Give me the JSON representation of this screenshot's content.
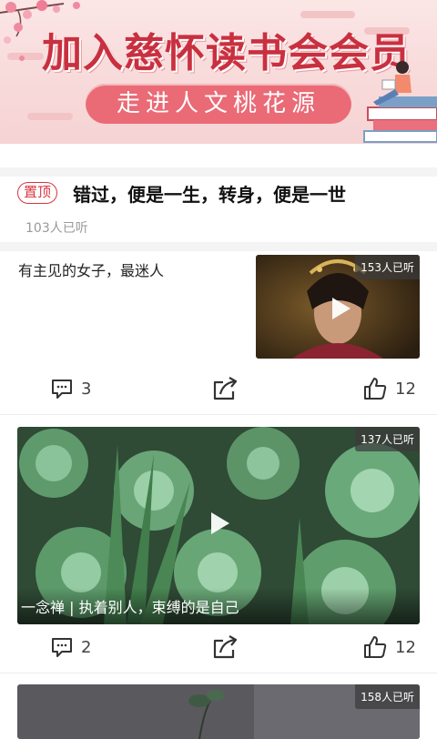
{
  "banner": {
    "title": "加入慈怀读书会会员",
    "subtitle": "走进人文桃花源"
  },
  "pinned": {
    "badge": "置顶",
    "title": "错过，便是一生，转身，便是一世",
    "listens": "103人已听"
  },
  "feed": [
    {
      "title": "有主见的女子，最迷人",
      "listens": "153人已听",
      "comments": "3",
      "likes": "12"
    },
    {
      "title": "一念禅 | 执着别人，束缚的是自己",
      "listens": "137人已听",
      "comments": "2",
      "likes": "12"
    },
    {
      "listens": "158人已听"
    }
  ],
  "icons": {
    "comment": "comment-icon",
    "share": "share-icon",
    "like": "thumbs-up-icon",
    "play": "play-icon"
  },
  "colors": {
    "accent": "#d9343f",
    "banner_title": "#c9303f",
    "banner_pill": "#ea6a75"
  }
}
